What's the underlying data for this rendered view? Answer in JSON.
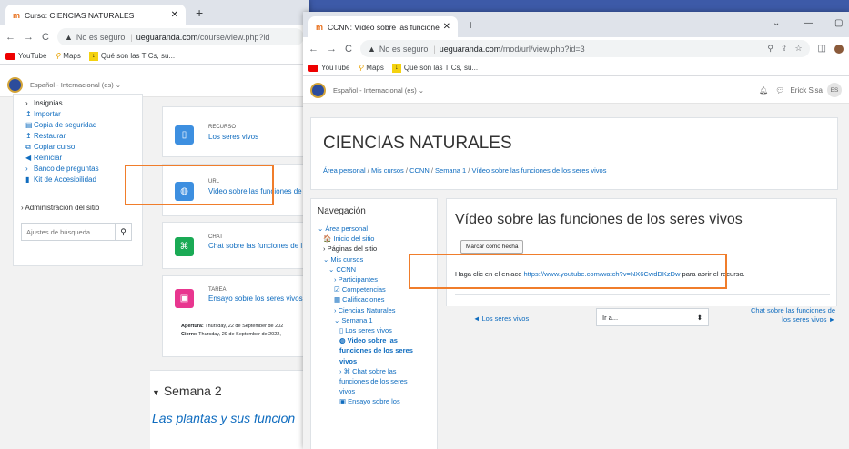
{
  "win1": {
    "tab_title": "Curso: CIENCIAS NATURALES",
    "url_warning": "No es seguro",
    "url_host": "ueguaranda.com",
    "url_path": "/course/view.php?id",
    "lang": "Español - Internacional (es)",
    "admin_menu": [
      {
        "icon": "chevron-right-icon",
        "label": "Insignias"
      },
      {
        "icon": "import-icon",
        "label": "Importar"
      },
      {
        "icon": "backup-icon",
        "label": "Copia de seguridad"
      },
      {
        "icon": "restore-icon",
        "label": "Restaurar"
      },
      {
        "icon": "copy-icon",
        "label": "Copiar curso"
      },
      {
        "icon": "reset-icon",
        "label": "Reiniciar"
      },
      {
        "icon": "chevron-right-icon",
        "label": "Banco de preguntas"
      },
      {
        "icon": "accessibility-icon",
        "label": "Kit de Accesibilidad"
      }
    ],
    "site_admin": "Administración del sitio",
    "search_placeholder": "Ajustes de búsqueda",
    "activities": [
      {
        "type": "RECURSO",
        "name": "Los seres vivos",
        "color": "#3d8fe0"
      },
      {
        "type": "URL",
        "name": "Video sobre las funciones de",
        "color": "#3d8fe0"
      },
      {
        "type": "CHAT",
        "name": "Chat sobre las funciones de l",
        "color": "#1aaa55"
      },
      {
        "type": "TAREA",
        "name": "Ensayo sobre los seres vivos",
        "color": "#e8368f"
      }
    ],
    "tarea_apertura_label": "Apertura:",
    "tarea_apertura": "Thursday, 22 de September de 202",
    "tarea_cierre_label": "Cierre:",
    "tarea_cierre": "Thursday, 29 de September de 2022,",
    "section_title": "Semana 2",
    "section_desc": "Las plantas y sus funcion"
  },
  "win2": {
    "tab_title": "CCNN: Vídeo sobre las funciones",
    "url_warning": "No es seguro",
    "url_host": "ueguaranda.com",
    "url_path": "/mod/url/view.php?id=3",
    "lang": "Español - Internacional (es)",
    "user_name": "Erick Sisa",
    "user_initials": "ES",
    "course_title": "CIENCIAS NATURALES",
    "breadcrumb": [
      "Área personal",
      "Mis cursos",
      "CCNN",
      "Semana 1",
      "Vídeo sobre las funciones de los seres vivos"
    ],
    "nav_title": "Navegación",
    "nav_items": [
      {
        "label": "Área personal",
        "prefix": "⌄",
        "indent": 0,
        "cls": "lnk"
      },
      {
        "label": "Inicio del sitio",
        "prefix": "🏠",
        "indent": 1,
        "cls": "lnk"
      },
      {
        "label": "Páginas del sitio",
        "prefix": "›",
        "indent": 1,
        "cls": ""
      },
      {
        "label": "Mis cursos",
        "prefix": "⌄",
        "indent": 1,
        "cls": "lnk"
      },
      {
        "label": "CCNN",
        "prefix": "⌄",
        "indent": 2,
        "cls": "lnk"
      },
      {
        "label": "Participantes",
        "prefix": "›",
        "indent": 3,
        "cls": "lnk"
      },
      {
        "label": "Competencias",
        "prefix": "☑",
        "indent": 3,
        "cls": "lnk"
      },
      {
        "label": "Calificaciones",
        "prefix": "▦",
        "indent": 3,
        "cls": "lnk"
      },
      {
        "label": "Ciencias Naturales",
        "prefix": "›",
        "indent": 3,
        "cls": "lnk"
      },
      {
        "label": "Semana 1",
        "prefix": "⌄",
        "indent": 3,
        "cls": "lnk"
      },
      {
        "label": "Los seres vivos",
        "prefix": "▯",
        "indent": 4,
        "cls": "lnk"
      },
      {
        "label": "Video sobre las funciones de los seres vivos",
        "prefix": "◍",
        "indent": 4,
        "cls": "bold"
      },
      {
        "label": "Chat sobre las funciones de los seres vivos",
        "prefix": "› ⌘",
        "indent": 4,
        "cls": "lnk"
      },
      {
        "label": "Ensayo sobre los",
        "prefix": "▣",
        "indent": 4,
        "cls": "lnk"
      }
    ],
    "page_heading": "Vídeo sobre las funciones de los seres vivos",
    "mark_done": "Marcar como hecha",
    "click_pre": "Haga clic en el enlace",
    "click_url": "https://www.youtube.com/watch?v=NX6CwdDKzDw",
    "click_post": "para abrir el recurso.",
    "prev_link": "◄ Los seres vivos",
    "jump_select": "Ir a...",
    "next_link": "Chat sobre las funciones de los seres vivos ►"
  },
  "bookmarks": [
    "YouTube",
    "Maps",
    "Qué son las TICs, su..."
  ]
}
